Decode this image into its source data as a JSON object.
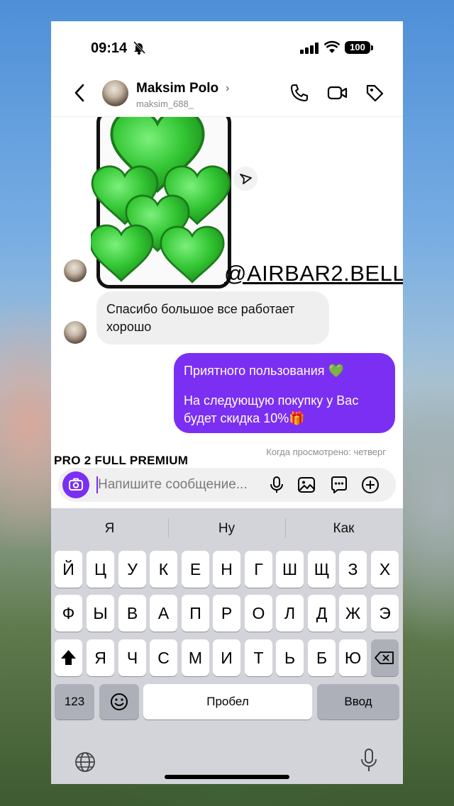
{
  "status_bar": {
    "time": "09:14",
    "battery": "100"
  },
  "header": {
    "name": "Maksim Polo",
    "username": "maksim_688_"
  },
  "chat": {
    "watermark": "@AIRBAR2.BELL",
    "incoming_message": "Спасибо большое все работает хорошо",
    "outgoing_message_line1": "Приятного пользования 💚",
    "outgoing_message_line2": "На следующую покупку у Вас будет скидка 10%🎁",
    "seen_status": "Когда просмотрено: четверг",
    "overlay_caption": "PRO 2 FULL PREMIUM"
  },
  "composer": {
    "placeholder": "Напишите сообщение..."
  },
  "keyboard": {
    "suggestions": [
      "Я",
      "Ну",
      "Как"
    ],
    "row1": [
      "Й",
      "Ц",
      "У",
      "К",
      "Е",
      "Н",
      "Г",
      "Ш",
      "Щ",
      "З",
      "Х"
    ],
    "row2": [
      "Ф",
      "Ы",
      "В",
      "А",
      "П",
      "Р",
      "О",
      "Л",
      "Д",
      "Ж",
      "Э"
    ],
    "row3": [
      "Я",
      "Ч",
      "С",
      "М",
      "И",
      "Т",
      "Ь",
      "Б",
      "Ю"
    ],
    "numbers_label": "123",
    "space_label": "Пробел",
    "return_label": "Ввод"
  },
  "colors": {
    "accent": "#7b2ff2",
    "hearts": "#3ed13e"
  },
  "icons": [
    "bell-slash-icon",
    "cellular-icon",
    "wifi-icon",
    "chevron-left-icon",
    "phone-icon",
    "video-icon",
    "tag-icon",
    "send-icon",
    "camera-icon",
    "microphone-icon",
    "image-icon",
    "sticker-icon",
    "plus-circle-icon",
    "shift-icon",
    "backspace-icon",
    "emoji-icon",
    "globe-icon"
  ]
}
